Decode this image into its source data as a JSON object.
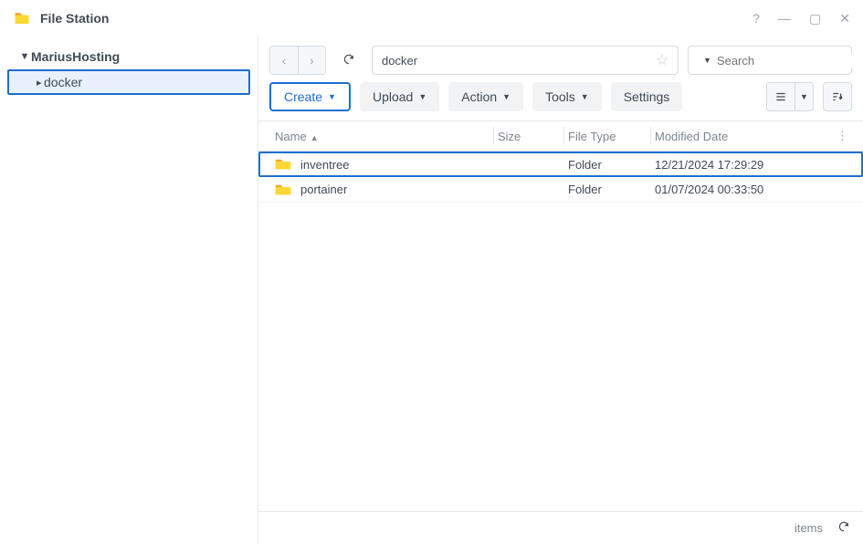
{
  "app": {
    "title": "File Station"
  },
  "sidebar": {
    "root": "MariusHosting",
    "items": [
      "docker"
    ]
  },
  "path": {
    "value": "docker"
  },
  "search": {
    "placeholder": "Search"
  },
  "toolbar": {
    "create": "Create",
    "upload": "Upload",
    "action": "Action",
    "tools": "Tools",
    "settings": "Settings"
  },
  "columns": {
    "name": "Name",
    "size": "Size",
    "type": "File Type",
    "date": "Modified Date"
  },
  "rows": [
    {
      "name": "inventree",
      "type": "Folder",
      "date": "12/21/2024 17:29:29",
      "selected": true
    },
    {
      "name": "portainer",
      "type": "Folder",
      "date": "01/07/2024 00:33:50",
      "selected": false
    }
  ],
  "status": {
    "items": "items"
  }
}
